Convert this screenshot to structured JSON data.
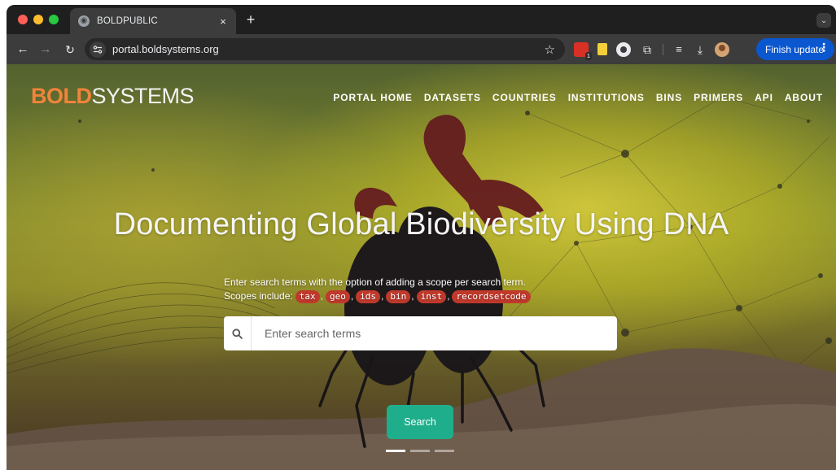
{
  "browser": {
    "tab": {
      "title": "BOLDPUBLIC",
      "close": "×"
    },
    "new_tab": "+",
    "tab_dropdown": "⌄",
    "url": "portal.boldsystems.org",
    "ext_badge_count": "1",
    "finish_update": "Finish update",
    "menu_dots": "⋮"
  },
  "site": {
    "logo": {
      "part1": "BOLD",
      "part2": "SYSTEMS"
    },
    "nav": [
      "PORTAL HOME",
      "DATASETS",
      "COUNTRIES",
      "INSTITUTIONS",
      "BINS",
      "PRIMERS",
      "API",
      "ABOUT"
    ],
    "headline": "Documenting Global Biodiversity Using DNA",
    "instructions": {
      "line1": "Enter search terms with the option of adding a scope per search term.",
      "line2_prefix": "Scopes include:",
      "scopes": [
        "tax",
        "geo",
        "ids",
        "bin",
        "inst",
        "recordsetcode"
      ],
      "separator": ","
    },
    "search": {
      "placeholder": "Enter search terms",
      "button": "Search"
    },
    "carousel": {
      "slides": 3,
      "active": 1
    }
  },
  "colors": {
    "logo_accent": "#f1843a",
    "search_button": "#1fae8b",
    "scope_chip": "#c0392b",
    "finish_update": "#0b57d0"
  }
}
